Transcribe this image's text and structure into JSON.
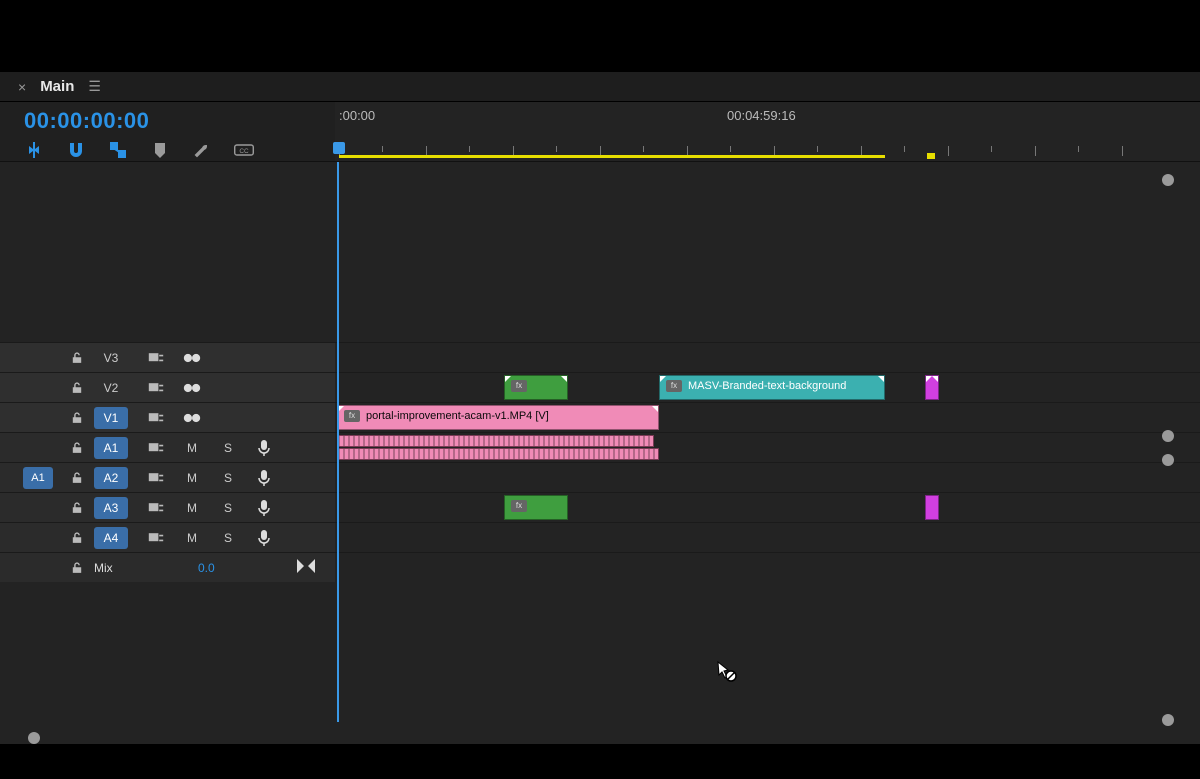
{
  "tab": {
    "title": "Main"
  },
  "timecode": "00:00:00:00",
  "ruler": {
    "labels": [
      ":00:00",
      "00:04:59:16"
    ]
  },
  "track_controls": {
    "mute": "M",
    "solo": "S",
    "fx": "fx"
  },
  "video_tracks": [
    {
      "id": "V3",
      "selected": false
    },
    {
      "id": "V2",
      "selected": false
    },
    {
      "id": "V1",
      "selected": true
    }
  ],
  "audio_tracks": [
    {
      "id": "A1",
      "selected": true
    },
    {
      "id": "A2",
      "selected": true
    },
    {
      "id": "A3",
      "selected": true
    },
    {
      "id": "A4",
      "selected": true
    }
  ],
  "source_patch": {
    "audio": "A1"
  },
  "mix": {
    "label": "Mix",
    "value": "0.0"
  },
  "clips": {
    "v2_green": {
      "label": ""
    },
    "v2_teal": {
      "label": "MASV-Branded-text-background"
    },
    "v1_pink": {
      "label": "portal-improvement-acam-v1.MP4 [V]"
    }
  }
}
